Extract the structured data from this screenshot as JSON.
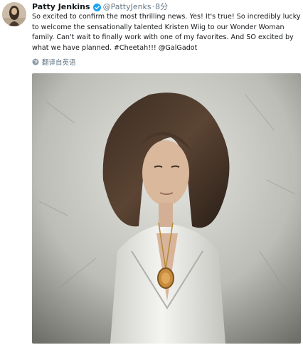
{
  "tweet": {
    "display_name": "Patty Jenkins",
    "handle": "@PattyJenks",
    "separator": "·",
    "time": "8分",
    "text": "So excited to confirm the most thrilling news. Yes! It's true! So incredibly lucky to welcome the sensationally talented Kristen Wiig to our Wonder Woman family. Can't wait to finally work with one of my favorites. And SO excited by what we have planned. #Cheetah!!! @GalGadot",
    "translate_label": "翻译自英语"
  },
  "icons": {
    "verified": "verified-badge-icon",
    "translate": "globe-icon"
  },
  "colors": {
    "name": "#14171a",
    "secondary": "#657786",
    "verified": "#1da1f2"
  }
}
